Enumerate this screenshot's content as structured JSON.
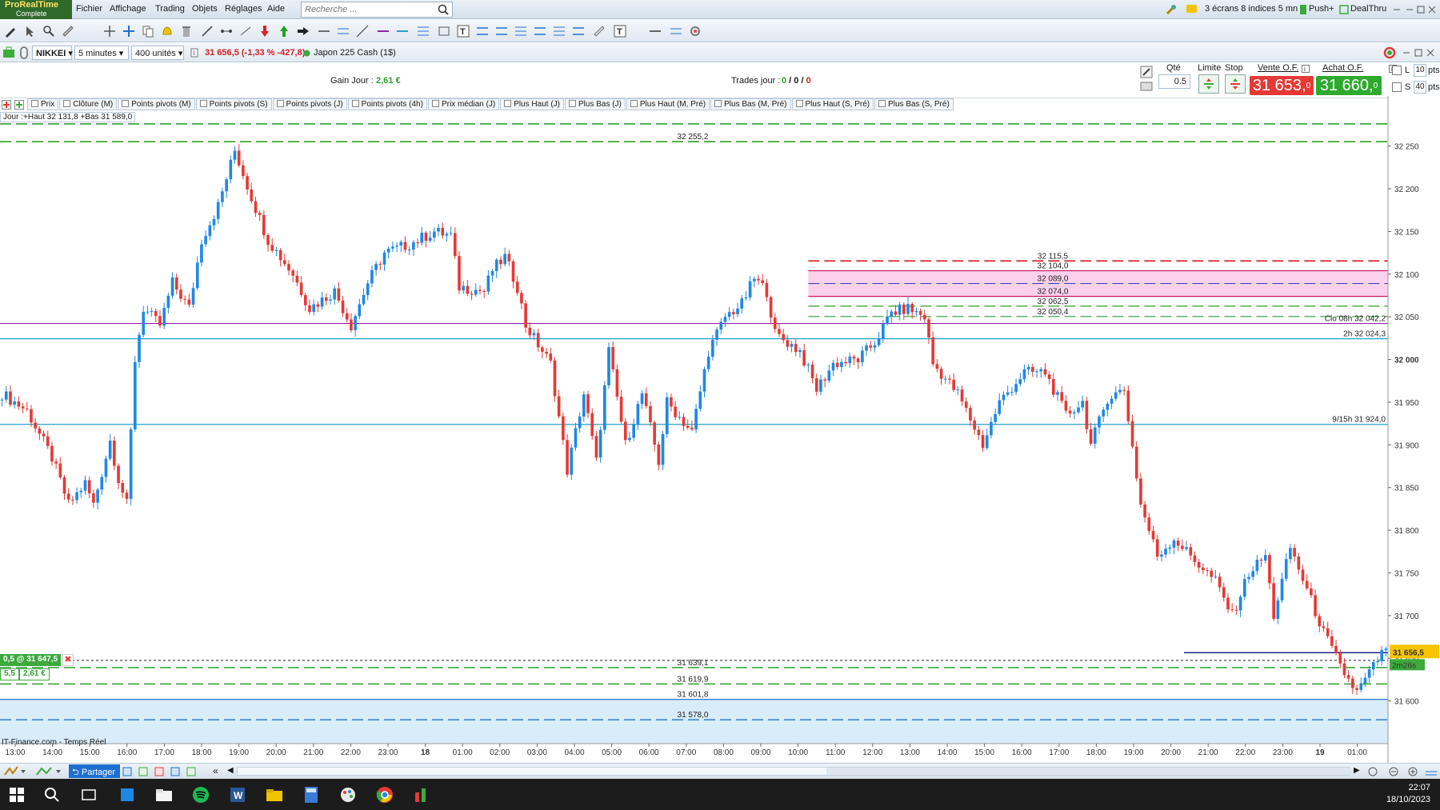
{
  "app": {
    "logo_line1": "ProRealTime",
    "logo_line2": "Complete"
  },
  "menu": {
    "items": [
      "Fichier",
      "Affichage",
      "Trading",
      "Objets",
      "Réglages",
      "Aide"
    ]
  },
  "search": {
    "placeholder": "Recherche ..."
  },
  "top_right": {
    "screens": "3 écrans 8 indices 5 mn",
    "push": "Push+",
    "dealthru": "DealThru"
  },
  "instrument": {
    "name": "NIKKEI",
    "timeframe": "5 minutes",
    "units": "400 unités",
    "quote": "31 656,5 (-1,33 % -427,8)",
    "description": "Japon 225 Cash (1$)"
  },
  "order_bar": {
    "gain_label": "Gain Jour :",
    "gain_value": "2,61 €",
    "trades_label": "Trades jour :",
    "trades_a": "0",
    "trades_b": "0",
    "trades_c": "0",
    "qty_label": "Qté",
    "qty_value": "0.5",
    "limit_label": "Limite",
    "stop_label": "Stop",
    "sell_label": "Vente O.F.",
    "buy_label": "Achat O.F.",
    "sell_price": "31 653,",
    "sell_sup": "0",
    "buy_price": "31 660,",
    "buy_sup": "0",
    "l_label": "L",
    "s_label": "S",
    "l_pts": "10",
    "s_pts": "40",
    "pts": "pts"
  },
  "indicator_tabs": [
    "Prix",
    "Clôture (M)",
    "Points pivots (M)",
    "Points pivots (S)",
    "Points pivots (J)",
    "Points pivots (4h)",
    "Prix médian (J)",
    "Plus Haut (J)",
    "Plus Bas (J)",
    "Plus Haut (M, Pré)",
    "Plus Bas (M, Pré)",
    "Plus Haut (S, Pré)",
    "Plus Bas (S, Pré)"
  ],
  "chart_info": "Jour :+Haut 32 131,8 +Bas 31 589,0",
  "position": {
    "label": "0,5 @ 31 647,5",
    "size": "5,5",
    "pnl": "2,61 €"
  },
  "source": "IT-Finance.com - Temps Réel",
  "chart_data": {
    "type": "candlestick",
    "ylim": [
      31550,
      32290
    ],
    "y_ticks": [
      {
        "v": 32250,
        "t": "32 250"
      },
      {
        "v": 32200,
        "t": "32 200"
      },
      {
        "v": 32150,
        "t": "32 150"
      },
      {
        "v": 32100,
        "t": "32 100"
      },
      {
        "v": 32050,
        "t": "32 050"
      },
      {
        "v": 32000,
        "t": "32 000"
      },
      {
        "v": 31950,
        "t": "31 950"
      },
      {
        "v": 31900,
        "t": "31 900"
      },
      {
        "v": 31850,
        "t": "31 850"
      },
      {
        "v": 31800,
        "t": "31 800"
      },
      {
        "v": 31750,
        "t": "31 750"
      },
      {
        "v": 31700,
        "t": "31 700"
      },
      {
        "v": 31650,
        "t": "31 650"
      },
      {
        "v": 31600,
        "t": "31 600"
      }
    ],
    "x_ticks": [
      "13:00",
      "14:00",
      "15:00",
      "16:00",
      "17:00",
      "18:00",
      "19:00",
      "20:00",
      "21:00",
      "22:00",
      "23:00",
      "18",
      "01:00",
      "02:00",
      "03:00",
      "04:00",
      "05:00",
      "06:00",
      "07:00",
      "08:00",
      "09:00",
      "10:00",
      "11:00",
      "12:00",
      "13:00",
      "14:00",
      "15:00",
      "16:00",
      "17:00",
      "18:00",
      "19:00",
      "20:00",
      "21:00",
      "22:00",
      "23:00",
      "19",
      "01:00"
    ],
    "path": [
      [
        0,
        31960
      ],
      [
        6,
        31940
      ],
      [
        12,
        31885
      ],
      [
        16,
        31830
      ],
      [
        20,
        31855
      ],
      [
        22,
        31830
      ],
      [
        26,
        31905
      ],
      [
        28,
        31860
      ],
      [
        30,
        31830
      ],
      [
        32,
        32000
      ],
      [
        34,
        32060
      ],
      [
        38,
        32040
      ],
      [
        41,
        32090
      ],
      [
        45,
        32060
      ],
      [
        48,
        32140
      ],
      [
        52,
        32180
      ],
      [
        56,
        32245
      ],
      [
        60,
        32190
      ],
      [
        64,
        32140
      ],
      [
        70,
        32100
      ],
      [
        74,
        32060
      ],
      [
        80,
        32080
      ],
      [
        84,
        32040
      ],
      [
        88,
        32090
      ],
      [
        92,
        32125
      ],
      [
        98,
        32135
      ],
      [
        104,
        32150
      ],
      [
        108,
        32145
      ],
      [
        110,
        32085
      ],
      [
        116,
        32080
      ],
      [
        118,
        32105
      ],
      [
        121,
        32120
      ],
      [
        124,
        32085
      ],
      [
        126,
        32040
      ],
      [
        132,
        31995
      ],
      [
        136,
        31870
      ],
      [
        140,
        31960
      ],
      [
        143,
        31880
      ],
      [
        146,
        32010
      ],
      [
        150,
        31900
      ],
      [
        154,
        31960
      ],
      [
        158,
        31880
      ],
      [
        160,
        31950
      ],
      [
        166,
        31915
      ],
      [
        170,
        32010
      ],
      [
        174,
        32050
      ],
      [
        178,
        32065
      ],
      [
        181,
        32095
      ],
      [
        184,
        32080
      ],
      [
        186,
        32030
      ],
      [
        192,
        32010
      ],
      [
        196,
        31965
      ],
      [
        200,
        31995
      ],
      [
        206,
        32000
      ],
      [
        210,
        32020
      ],
      [
        214,
        32055
      ],
      [
        218,
        32060
      ],
      [
        222,
        32050
      ],
      [
        224,
        31995
      ],
      [
        230,
        31960
      ],
      [
        236,
        31900
      ],
      [
        240,
        31950
      ],
      [
        246,
        31985
      ],
      [
        251,
        31985
      ],
      [
        256,
        31935
      ],
      [
        260,
        31950
      ],
      [
        262,
        31900
      ],
      [
        266,
        31955
      ],
      [
        270,
        31965
      ],
      [
        274,
        31830
      ],
      [
        278,
        31770
      ],
      [
        282,
        31790
      ],
      [
        286,
        31770
      ],
      [
        292,
        31740
      ],
      [
        296,
        31700
      ],
      [
        300,
        31750
      ],
      [
        304,
        31770
      ],
      [
        306,
        31700
      ],
      [
        310,
        31780
      ],
      [
        314,
        31730
      ],
      [
        318,
        31680
      ],
      [
        322,
        31640
      ],
      [
        326,
        31610
      ],
      [
        330,
        31640
      ],
      [
        332,
        31656
      ]
    ],
    "levels": [
      {
        "v": 32276,
        "label": "",
        "color": "#2e9e2e",
        "style": "dash"
      },
      {
        "v": 32255.2,
        "label": "32 255,2",
        "color": "#2e9e2e",
        "style": "dash"
      },
      {
        "v": 32115.5,
        "label": "32 115,5",
        "color": "#d11a1a",
        "style": "dash"
      },
      {
        "v": 32104.0,
        "label": "32 104,0",
        "color": "#c2185b",
        "style": "solid"
      },
      {
        "v": 32089.0,
        "label": "32 089,0",
        "color": "#3949ab",
        "style": "dash"
      },
      {
        "v": 32074.0,
        "label": "32 074,0",
        "color": "#c2185b",
        "style": "solid"
      },
      {
        "v": 32062.5,
        "label": "32 062,5",
        "color": "#2e9e2e",
        "style": "dash"
      },
      {
        "v": 32050.4,
        "label": "32 050,4",
        "color": "#2e9e2e",
        "style": "dash"
      },
      {
        "v": 32042.2,
        "label": "Clo 08h 32 042,2",
        "color": "#8e24aa",
        "style": "solid"
      },
      {
        "v": 32024.3,
        "label": "2h 32 024,3",
        "color": "#26a0c9",
        "style": "solid"
      },
      {
        "v": 31924.0,
        "label": "9/15h 31 924,0",
        "color": "#26a0c9",
        "style": "solid"
      },
      {
        "v": 31639.1,
        "label": "31 639,1",
        "color": "#2e9e2e",
        "style": "dash"
      },
      {
        "v": 31619.9,
        "label": "31 619,9",
        "color": "#2e9e2e",
        "style": "dash"
      },
      {
        "v": 31601.8,
        "label": "31 601,8",
        "color": "#1565c0",
        "style": "solid"
      },
      {
        "v": 31578.0,
        "label": "31 578,0",
        "color": "#1565c0",
        "style": "dash"
      }
    ],
    "position_price": 31647.5,
    "last_price": 31656.5,
    "last_label": "31 656,5",
    "countdown": "2m26s"
  },
  "bottom": {
    "share": "Partager"
  },
  "clock": {
    "time": "22:07",
    "date": "18/10/2023"
  },
  "colors": {
    "up": "#1e88e5",
    "down": "#e53935",
    "zone_fill": "#fbd1ec",
    "blue_zone": "#d8ecfa"
  }
}
